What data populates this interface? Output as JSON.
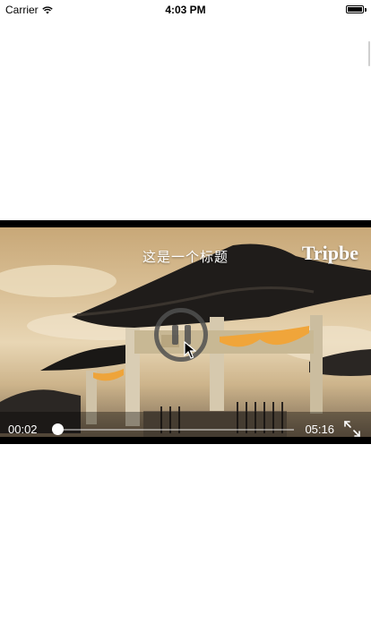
{
  "status_bar": {
    "carrier": "Carrier",
    "time": "4:03 PM"
  },
  "player": {
    "title": "这是一个标题",
    "logo": "Tripbe",
    "state": "paused-icon-shown",
    "controls": {
      "current_time": "00:02",
      "total_time": "05:16",
      "progress_fraction": 0.006
    }
  },
  "icons": {
    "wifi": "wifi-icon",
    "battery": "battery-icon",
    "play_pause": "pause-icon",
    "fullscreen": "fullscreen-expand-icon",
    "cursor": "mouse-pointer-icon"
  }
}
